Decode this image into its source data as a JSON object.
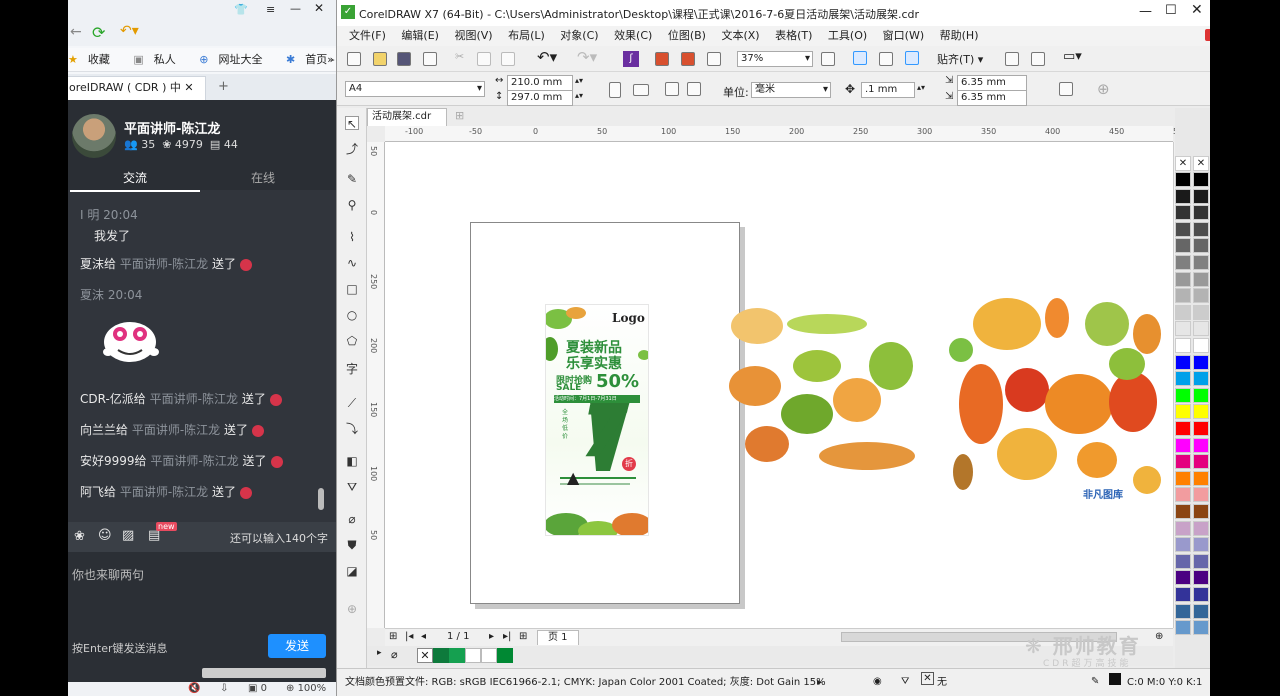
{
  "browser": {
    "favorites": [
      "收藏",
      "私人",
      "网址大全",
      "首页 - 邢"
    ],
    "tab_title": "oreIDRAW ( CDR ) 中",
    "tab_add": "+",
    "chat": {
      "user_name": "平面讲师-陈江龙",
      "stat_members": "35",
      "stat_flowers": "4979",
      "stat_gifts": "44",
      "tab_chat": "交流",
      "tab_online": "在线",
      "messages": [
        {
          "sender": "I 明 20:04",
          "text": "我发了"
        },
        {
          "line": "夏沫给",
          "target": "平面讲师-陈江龙",
          "action": "送了"
        },
        {
          "sender": "夏沫 20:04"
        },
        {
          "line": "CDR-亿派给",
          "target": "平面讲师-陈江龙",
          "action": "送了"
        },
        {
          "line": "向兰兰给",
          "target": "平面讲师-陈江龙",
          "action": "送了"
        },
        {
          "line": "安好9999给",
          "target": "平面讲师-陈江龙",
          "action": "送了"
        },
        {
          "line": "阿飞给",
          "target": "平面讲师-陈江龙",
          "action": "送了"
        }
      ],
      "char_limit": "还可以输入140个字",
      "new_badge": "new",
      "placeholder": "你也来聊两句",
      "enter_hint": "按Enter键发送消息",
      "send_label": "发送"
    },
    "status": {
      "zoom": "100%",
      "count": "0"
    }
  },
  "corel": {
    "title": "CorelDRAW X7 (64-Bit) - C:\\Users\\Administrator\\Desktop\\课程\\正式课\\2016-7-6夏日活动展架\\活动展架.cdr",
    "menu": [
      "文件(F)",
      "编辑(E)",
      "视图(V)",
      "布局(L)",
      "对象(C)",
      "效果(C)",
      "位图(B)",
      "文本(X)",
      "表格(T)",
      "工具(O)",
      "窗口(W)",
      "帮助(H)"
    ],
    "zoom": "37%",
    "snap": "贴齐(T)",
    "page_size": "A4",
    "width": "210.0 mm",
    "height": "297.0 mm",
    "unit_label": "单位:",
    "unit": "毫米",
    "nudge": ".1 mm",
    "dup_x": "6.35 mm",
    "dup_y": "6.35 mm",
    "doc_tab": "活动展架.cdr",
    "hruler": [
      "-100",
      "-50",
      "0",
      "50",
      "100",
      "150",
      "200",
      "250",
      "300",
      "350",
      "400",
      "450",
      "500"
    ],
    "vruler": [
      "50",
      "0",
      "250",
      "200",
      "150",
      "100",
      "50"
    ],
    "page_indicator": "1 / 1",
    "page_tab": "页 1",
    "status_text": "文档颜色预置文件: RGB: sRGB IEC61966-2.1; CMYK: Japan Color 2001 Coated; 灰度: Dot Gain 15%",
    "fill_none": "无",
    "cmyk_readout": "C:0 M:0 Y:0 K:1",
    "watermark": "邢帅教育",
    "watermark_sub": "CDR超万高技能",
    "poster": {
      "logo": "Logo",
      "headline1": "夏装新品",
      "headline2": "乐享实惠",
      "promo": "限时抢购",
      "sale": "SALE",
      "percent": "50%",
      "dates": "活动时间：7月1日-7月31日",
      "vertical": "全场低价",
      "big_number": "7",
      "discount": "折"
    },
    "leaves_brand": "非凡图库"
  },
  "colors": {
    "palette": [
      "#000000",
      "#1a1a1a",
      "#333333",
      "#4d4d4d",
      "#666666",
      "#808080",
      "#999999",
      "#b3b3b3",
      "#cccccc",
      "#e6e6e6",
      "#ffffff",
      "#0000ff",
      "#00a0e9",
      "#00ff00",
      "#ffff00",
      "#ff0000",
      "#ff00ff",
      "#e4007f",
      "#ff8000",
      "#f29c9f",
      "#8b4513",
      "#c8a2c8",
      "#9999cc",
      "#6666aa",
      "#4b0082",
      "#333399",
      "#336699",
      "#6699cc"
    ]
  }
}
